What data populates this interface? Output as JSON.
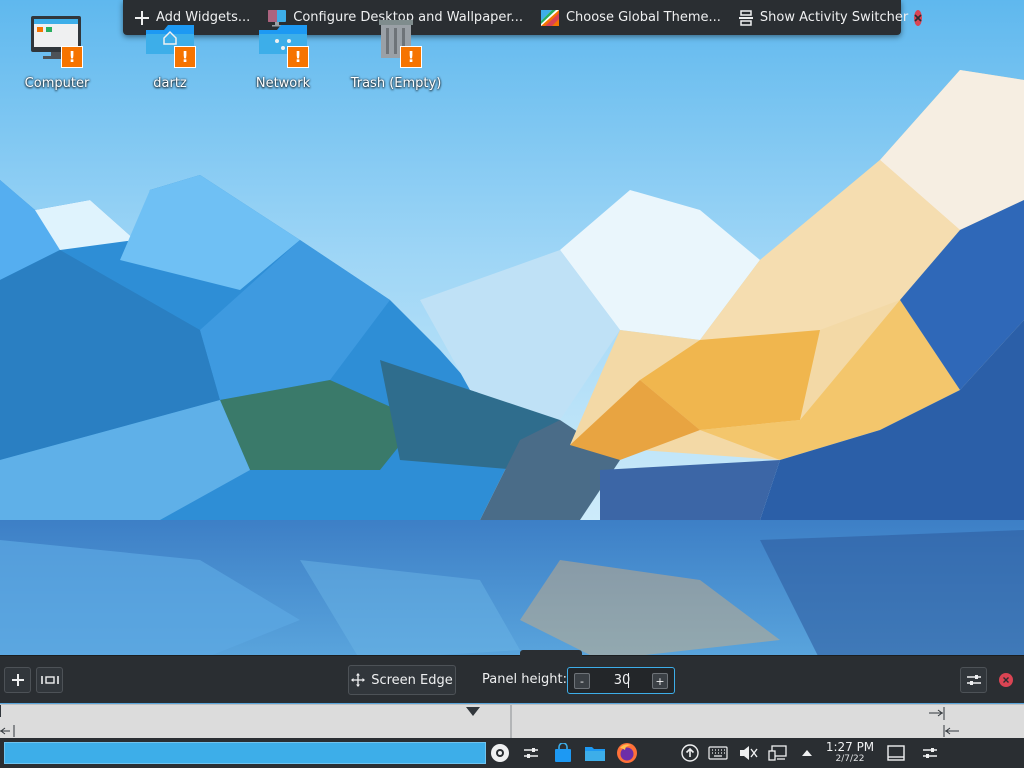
{
  "toolbox": {
    "add_widgets": "Add Widgets...",
    "configure_desktop": "Configure Desktop and Wallpaper...",
    "global_theme": "Choose Global Theme...",
    "activity_switcher": "Show Activity Switcher"
  },
  "desktop_icons": [
    {
      "label": "Computer",
      "icon": "computer-icon"
    },
    {
      "label": "dartz",
      "icon": "home-folder-icon"
    },
    {
      "label": "Network",
      "icon": "network-folder-icon"
    },
    {
      "label": "Trash (Empty)",
      "icon": "trash-icon"
    }
  ],
  "warning_glyph": "!",
  "panel_config": {
    "screen_edge_label": "Screen Edge",
    "panel_height_label": "Panel height:",
    "panel_height_value": "30",
    "decrement": "-",
    "increment": "+"
  },
  "taskbar": {
    "clock_time": "1:27 PM",
    "clock_date": "2/7/22"
  },
  "colors": {
    "accent": "#3daee9",
    "panel_bg": "#2a2e32",
    "close_red": "#da4453",
    "warning_orange": "#f67400"
  }
}
